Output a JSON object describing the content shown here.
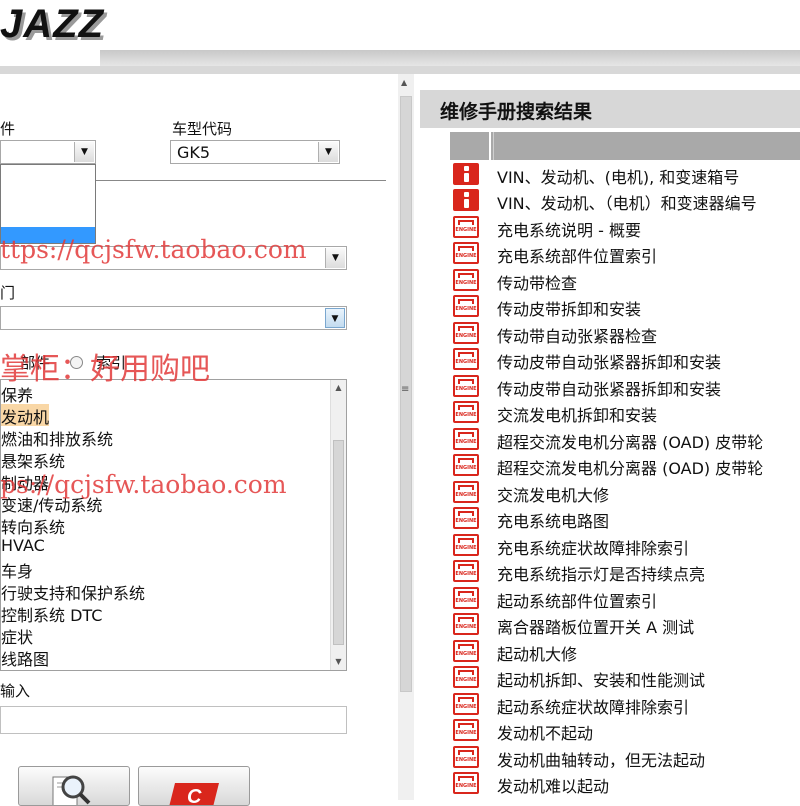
{
  "header": {
    "logo": "JAZZ"
  },
  "left": {
    "partial_label": "件",
    "model_code_label": "车型代码",
    "model_code_value": "GK5",
    "category_partial_label": "门",
    "radio_option_component": "部件",
    "radio_option_index": "索引",
    "list_items": [
      "保养",
      "发动机",
      "燃油和排放系统",
      "悬架系统",
      "制动器",
      "变速/传动系统",
      "转向系统",
      "HVAC",
      "车身",
      "行驶支持和保护系统",
      "控制系统 DTC",
      "症状",
      "线路图"
    ],
    "keyword_label": "输入"
  },
  "results": {
    "title": "维修手册搜索结果",
    "rows": [
      {
        "icon": "info-icon",
        "text": "VIN、发动机、(电机), 和变速箱号"
      },
      {
        "icon": "info-icon",
        "text": "VIN、发动机、（电机）和变速器编号"
      },
      {
        "icon": "engine-icon",
        "text": "充电系统说明 - 概要"
      },
      {
        "icon": "engine-icon",
        "text": "充电系统部件位置索引"
      },
      {
        "icon": "engine-icon",
        "text": "传动带检查"
      },
      {
        "icon": "engine-icon",
        "text": "传动皮带拆卸和安装"
      },
      {
        "icon": "engine-icon",
        "text": "传动带自动张紧器检查"
      },
      {
        "icon": "engine-icon",
        "text": "传动皮带自动张紧器拆卸和安装"
      },
      {
        "icon": "engine-icon",
        "text": "传动皮带自动张紧器拆卸和安装"
      },
      {
        "icon": "engine-icon",
        "text": "交流发电机拆卸和安装"
      },
      {
        "icon": "engine-icon",
        "text": "超程交流发电机分离器 (OAD) 皮带轮"
      },
      {
        "icon": "engine-icon",
        "text": "超程交流发电机分离器 (OAD) 皮带轮"
      },
      {
        "icon": "engine-icon",
        "text": "交流发电机大修"
      },
      {
        "icon": "engine-icon",
        "text": "充电系统电路图"
      },
      {
        "icon": "engine-icon",
        "text": "充电系统症状故障排除索引"
      },
      {
        "icon": "engine-icon",
        "text": "充电系统指示灯是否持续点亮"
      },
      {
        "icon": "engine-icon",
        "text": "起动系统部件位置索引"
      },
      {
        "icon": "engine-icon",
        "text": "离合器踏板位置开关 A 测试"
      },
      {
        "icon": "engine-icon",
        "text": "起动机大修"
      },
      {
        "icon": "engine-icon",
        "text": "起动机拆卸、安装和性能测试"
      },
      {
        "icon": "engine-icon",
        "text": "起动系统症状故障排除索引"
      },
      {
        "icon": "engine-icon",
        "text": "发动机不起动"
      },
      {
        "icon": "engine-icon",
        "text": "发动机曲轴转动，但无法起动"
      },
      {
        "icon": "engine-icon",
        "text": "发动机难以起动"
      }
    ]
  },
  "watermarks": {
    "url1": "ttps://qcjsfw.taobao.com",
    "shop": "掌柜：好用购吧",
    "url2": "ps://qcjsfw.taobao.com"
  },
  "colors": {
    "accent_red": "#d9261c",
    "selection_blue": "#3399ff",
    "highlight": "#f9d7a6",
    "watermark": "#e23a3a"
  }
}
